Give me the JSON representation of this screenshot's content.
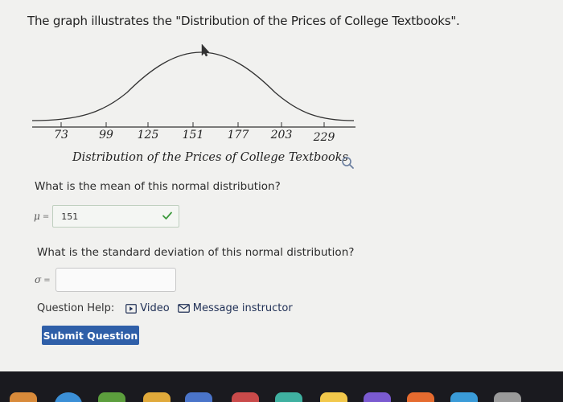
{
  "heading": "The graph illustrates the \"Distribution of the Prices of College Textbooks\".",
  "graph": {
    "tick_labels": [
      "73",
      "99",
      "125",
      "151",
      "177",
      "203",
      "229"
    ],
    "axis_title": "Distribution of the Prices of College Textbooks",
    "magnify_icon": "magnifying-glass-icon"
  },
  "q1": {
    "text": "What is the mean of this normal distribution?",
    "symbol": "μ",
    "equals": "=",
    "answer": "151",
    "status_icon": "checkmark-icon"
  },
  "q2": {
    "text": "What is the standard deviation of this normal distribution?",
    "symbol": "σ",
    "equals": "=",
    "answer": ""
  },
  "help": {
    "label": "Question Help:",
    "video": "Video",
    "message": "Message instructor"
  },
  "submit_label": "Submit Question",
  "colors": {
    "accent": "#2f5fa8",
    "check": "#3d9a3d",
    "dock": "#1a1a1f"
  }
}
